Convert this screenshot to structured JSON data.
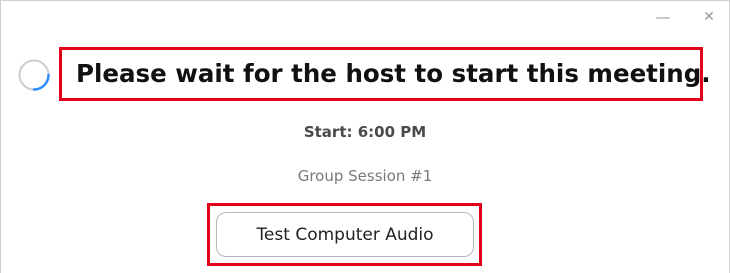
{
  "window": {
    "minimize_glyph": "—",
    "close_glyph": "✕"
  },
  "icons": {
    "loading": "loading-spinner-icon"
  },
  "main": {
    "headline": "Please wait for the host to start this meeting.",
    "start_time": "Start: 6:00 PM",
    "session_name": "Group Session #1",
    "test_audio_label": "Test Computer Audio"
  },
  "colors": {
    "highlight": "#e3001b",
    "spinner": "#2d8cff"
  }
}
